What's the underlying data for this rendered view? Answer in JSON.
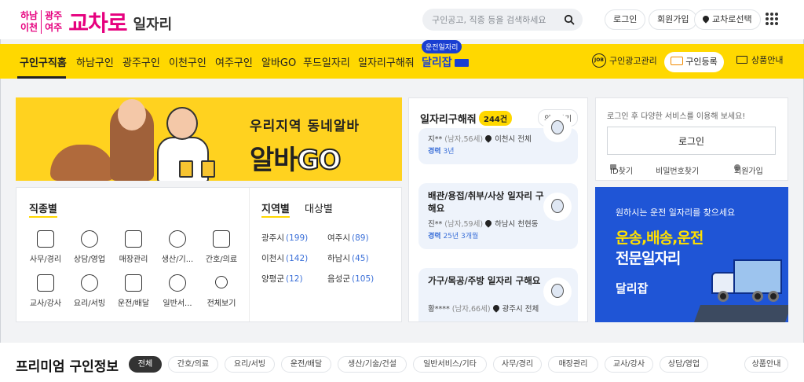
{
  "header": {
    "logo_regions": [
      "하남",
      "광주",
      "이천",
      "여주"
    ],
    "logo_main": "교차로",
    "logo_sub": "일자리",
    "search_placeholder": "구인공고, 직종 등을 검색하세요",
    "login_label": "로그인",
    "signup_label": "회원가입",
    "region_select_label": "교차로선택"
  },
  "nav": {
    "items": [
      "구인구직홈",
      "하남구인",
      "광주구인",
      "이천구인",
      "여주구인",
      "알바GO",
      "푸드일자리",
      "일자리구해줘"
    ],
    "dallijap_label": "달리잡",
    "dallijap_tag": "운전일자리",
    "ad_manage_label": "구인광고관리",
    "register_label": "구인등록",
    "product_info_label": "상품안내",
    "job_icon_text": "JOB"
  },
  "banner_albago": {
    "line1": "우리지역 동네알바",
    "line2_part1": "알바",
    "line2_part2": "GO"
  },
  "categories": {
    "title": "직종별",
    "items": [
      "사무/경리",
      "상담/영업",
      "매장관리",
      "생산/기...",
      "간호/의료",
      "교사/강사",
      "요리/서빙",
      "운전/배달",
      "일반서...",
      "전체보기"
    ]
  },
  "regions": {
    "tab_region": "지역별",
    "tab_target": "대상별",
    "items": [
      {
        "name": "광주시",
        "count": "(199)"
      },
      {
        "name": "여주시",
        "count": "(89)"
      },
      {
        "name": "이천시",
        "count": "(142)"
      },
      {
        "name": "하남시",
        "count": "(45)"
      },
      {
        "name": "양평군",
        "count": "(12)"
      },
      {
        "name": "음성군",
        "count": "(105)"
      }
    ]
  },
  "feed": {
    "title": "일자리구해줘",
    "count": "244건",
    "request_label": "의뢰하기",
    "posts": [
      {
        "title": "",
        "person": "지**",
        "info": "(남자,56세)",
        "location": "이천시 전체",
        "career_label": "경력",
        "career": "3년"
      },
      {
        "title": "배관/용접/취부/사상 일자리 구해요",
        "person": "진**",
        "info": "(남자,59세)",
        "location": "하남시 천현동",
        "career_label": "경력",
        "career": "25년 3개월"
      },
      {
        "title": "가구/목공/주방 일자리 구해요",
        "person": "황****",
        "info": "(남자,66세)",
        "location": "광주시 전체",
        "career_label": "",
        "career": ""
      }
    ]
  },
  "login_card": {
    "hint": "로그인 후 다양한 서비스를 이용해 보세요!",
    "login_button": "로그인",
    "find_id": "ID찾기",
    "find_pw": "비밀번호찾기",
    "signup": "회원가입"
  },
  "truck_banner": {
    "line1": "원하시는 운전 일자리를 찾으세요",
    "line2": "운송,배송,운전",
    "line3": "전문일자리",
    "brand": "달리잡"
  },
  "premium": {
    "title": "프리미엄 구인정보",
    "chips": [
      "전체",
      "간호/의료",
      "요리/서빙",
      "운전/배달",
      "생산/기술/건설",
      "일반서비스/기타",
      "사무/경리",
      "매장관리",
      "교사/강사",
      "상담/영업"
    ],
    "product_info": "상품안내"
  },
  "colors": {
    "brand_pink": "#e6007e",
    "nav_yellow": "#ffd800",
    "accent_blue": "#1a3fd1"
  }
}
